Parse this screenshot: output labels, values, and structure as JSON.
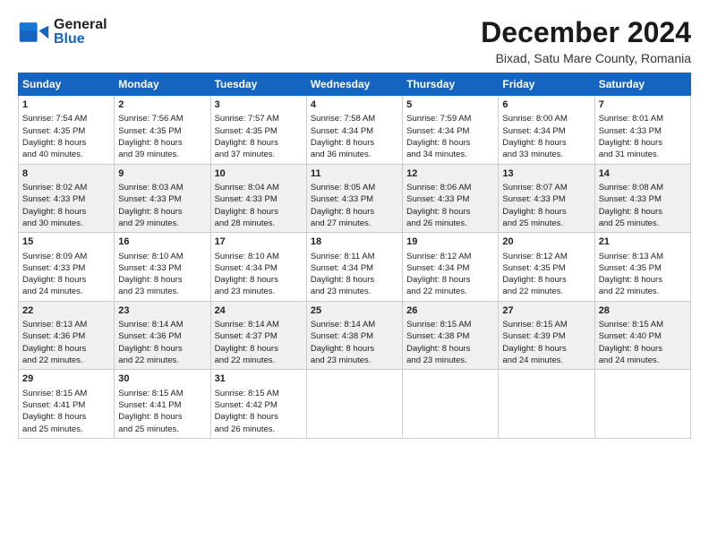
{
  "header": {
    "logo_general": "General",
    "logo_blue": "Blue",
    "title": "December 2024",
    "subtitle": "Bixad, Satu Mare County, Romania"
  },
  "columns": [
    "Sunday",
    "Monday",
    "Tuesday",
    "Wednesday",
    "Thursday",
    "Friday",
    "Saturday"
  ],
  "weeks": [
    [
      {
        "day": "1",
        "lines": [
          "Sunrise: 7:54 AM",
          "Sunset: 4:35 PM",
          "Daylight: 8 hours",
          "and 40 minutes."
        ]
      },
      {
        "day": "2",
        "lines": [
          "Sunrise: 7:56 AM",
          "Sunset: 4:35 PM",
          "Daylight: 8 hours",
          "and 39 minutes."
        ]
      },
      {
        "day": "3",
        "lines": [
          "Sunrise: 7:57 AM",
          "Sunset: 4:35 PM",
          "Daylight: 8 hours",
          "and 37 minutes."
        ]
      },
      {
        "day": "4",
        "lines": [
          "Sunrise: 7:58 AM",
          "Sunset: 4:34 PM",
          "Daylight: 8 hours",
          "and 36 minutes."
        ]
      },
      {
        "day": "5",
        "lines": [
          "Sunrise: 7:59 AM",
          "Sunset: 4:34 PM",
          "Daylight: 8 hours",
          "and 34 minutes."
        ]
      },
      {
        "day": "6",
        "lines": [
          "Sunrise: 8:00 AM",
          "Sunset: 4:34 PM",
          "Daylight: 8 hours",
          "and 33 minutes."
        ]
      },
      {
        "day": "7",
        "lines": [
          "Sunrise: 8:01 AM",
          "Sunset: 4:33 PM",
          "Daylight: 8 hours",
          "and 31 minutes."
        ]
      }
    ],
    [
      {
        "day": "8",
        "lines": [
          "Sunrise: 8:02 AM",
          "Sunset: 4:33 PM",
          "Daylight: 8 hours",
          "and 30 minutes."
        ]
      },
      {
        "day": "9",
        "lines": [
          "Sunrise: 8:03 AM",
          "Sunset: 4:33 PM",
          "Daylight: 8 hours",
          "and 29 minutes."
        ]
      },
      {
        "day": "10",
        "lines": [
          "Sunrise: 8:04 AM",
          "Sunset: 4:33 PM",
          "Daylight: 8 hours",
          "and 28 minutes."
        ]
      },
      {
        "day": "11",
        "lines": [
          "Sunrise: 8:05 AM",
          "Sunset: 4:33 PM",
          "Daylight: 8 hours",
          "and 27 minutes."
        ]
      },
      {
        "day": "12",
        "lines": [
          "Sunrise: 8:06 AM",
          "Sunset: 4:33 PM",
          "Daylight: 8 hours",
          "and 26 minutes."
        ]
      },
      {
        "day": "13",
        "lines": [
          "Sunrise: 8:07 AM",
          "Sunset: 4:33 PM",
          "Daylight: 8 hours",
          "and 25 minutes."
        ]
      },
      {
        "day": "14",
        "lines": [
          "Sunrise: 8:08 AM",
          "Sunset: 4:33 PM",
          "Daylight: 8 hours",
          "and 25 minutes."
        ]
      }
    ],
    [
      {
        "day": "15",
        "lines": [
          "Sunrise: 8:09 AM",
          "Sunset: 4:33 PM",
          "Daylight: 8 hours",
          "and 24 minutes."
        ]
      },
      {
        "day": "16",
        "lines": [
          "Sunrise: 8:10 AM",
          "Sunset: 4:33 PM",
          "Daylight: 8 hours",
          "and 23 minutes."
        ]
      },
      {
        "day": "17",
        "lines": [
          "Sunrise: 8:10 AM",
          "Sunset: 4:34 PM",
          "Daylight: 8 hours",
          "and 23 minutes."
        ]
      },
      {
        "day": "18",
        "lines": [
          "Sunrise: 8:11 AM",
          "Sunset: 4:34 PM",
          "Daylight: 8 hours",
          "and 23 minutes."
        ]
      },
      {
        "day": "19",
        "lines": [
          "Sunrise: 8:12 AM",
          "Sunset: 4:34 PM",
          "Daylight: 8 hours",
          "and 22 minutes."
        ]
      },
      {
        "day": "20",
        "lines": [
          "Sunrise: 8:12 AM",
          "Sunset: 4:35 PM",
          "Daylight: 8 hours",
          "and 22 minutes."
        ]
      },
      {
        "day": "21",
        "lines": [
          "Sunrise: 8:13 AM",
          "Sunset: 4:35 PM",
          "Daylight: 8 hours",
          "and 22 minutes."
        ]
      }
    ],
    [
      {
        "day": "22",
        "lines": [
          "Sunrise: 8:13 AM",
          "Sunset: 4:36 PM",
          "Daylight: 8 hours",
          "and 22 minutes."
        ]
      },
      {
        "day": "23",
        "lines": [
          "Sunrise: 8:14 AM",
          "Sunset: 4:36 PM",
          "Daylight: 8 hours",
          "and 22 minutes."
        ]
      },
      {
        "day": "24",
        "lines": [
          "Sunrise: 8:14 AM",
          "Sunset: 4:37 PM",
          "Daylight: 8 hours",
          "and 22 minutes."
        ]
      },
      {
        "day": "25",
        "lines": [
          "Sunrise: 8:14 AM",
          "Sunset: 4:38 PM",
          "Daylight: 8 hours",
          "and 23 minutes."
        ]
      },
      {
        "day": "26",
        "lines": [
          "Sunrise: 8:15 AM",
          "Sunset: 4:38 PM",
          "Daylight: 8 hours",
          "and 23 minutes."
        ]
      },
      {
        "day": "27",
        "lines": [
          "Sunrise: 8:15 AM",
          "Sunset: 4:39 PM",
          "Daylight: 8 hours",
          "and 24 minutes."
        ]
      },
      {
        "day": "28",
        "lines": [
          "Sunrise: 8:15 AM",
          "Sunset: 4:40 PM",
          "Daylight: 8 hours",
          "and 24 minutes."
        ]
      }
    ],
    [
      {
        "day": "29",
        "lines": [
          "Sunrise: 8:15 AM",
          "Sunset: 4:41 PM",
          "Daylight: 8 hours",
          "and 25 minutes."
        ]
      },
      {
        "day": "30",
        "lines": [
          "Sunrise: 8:15 AM",
          "Sunset: 4:41 PM",
          "Daylight: 8 hours",
          "and 25 minutes."
        ]
      },
      {
        "day": "31",
        "lines": [
          "Sunrise: 8:15 AM",
          "Sunset: 4:42 PM",
          "Daylight: 8 hours",
          "and 26 minutes."
        ]
      },
      {
        "day": "",
        "lines": []
      },
      {
        "day": "",
        "lines": []
      },
      {
        "day": "",
        "lines": []
      },
      {
        "day": "",
        "lines": []
      }
    ]
  ]
}
